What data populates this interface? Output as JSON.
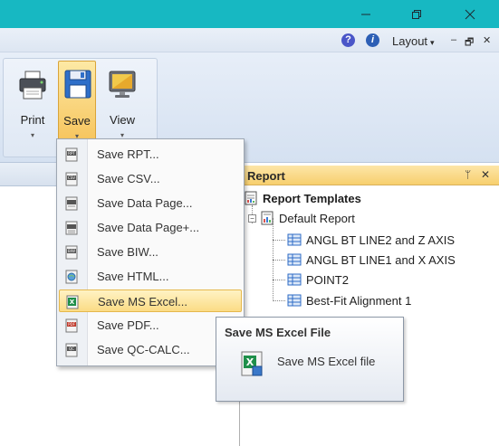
{
  "window": {
    "minimize_icon": "minimize-icon",
    "restore_icon": "restore-icon",
    "close_icon": "close-icon",
    "title_color": "#17b8c2"
  },
  "ribbon_top": {
    "layout_label": "Layout",
    "layout_caret": "▾",
    "minimize_glyph": "–",
    "restore_glyph": "🗗",
    "close_glyph": "✕"
  },
  "ribbon": {
    "print_label": "Print",
    "save_label": "Save",
    "view_label": "View",
    "dropdown_glyph": "▾"
  },
  "save_menu": {
    "items": [
      {
        "label": "Save RPT...",
        "icon": "rpt-file-icon"
      },
      {
        "label": "Save CSV...",
        "icon": "csv-file-icon"
      },
      {
        "label": "Save Data Page...",
        "icon": "data-page-icon"
      },
      {
        "label": "Save Data Page+...",
        "icon": "data-page-plus-icon"
      },
      {
        "label": "Save BIW...",
        "icon": "biw-file-icon"
      },
      {
        "label": "Save HTML...",
        "icon": "html-file-icon"
      },
      {
        "label": "Save MS Excel...",
        "icon": "excel-file-icon"
      },
      {
        "label": "Save PDF...",
        "icon": "pdf-file-icon"
      },
      {
        "label": "Save QC-CALC...",
        "icon": "qc-calc-file-icon"
      }
    ],
    "highlighted_index": 6
  },
  "tooltip": {
    "title": "Save MS Excel File",
    "description": "Save MS Excel file"
  },
  "report_panel": {
    "title": "Report",
    "pin_glyph": "ᛘ",
    "close_glyph": "✕",
    "tree": {
      "root": "Report Templates",
      "child": "Default Report",
      "expander": "−",
      "items": [
        "ANGL BT LINE2 and Z AXIS",
        "ANGL BT LINE1 and X AXIS",
        "POINT2",
        "Best-Fit Alignment 1"
      ]
    }
  }
}
